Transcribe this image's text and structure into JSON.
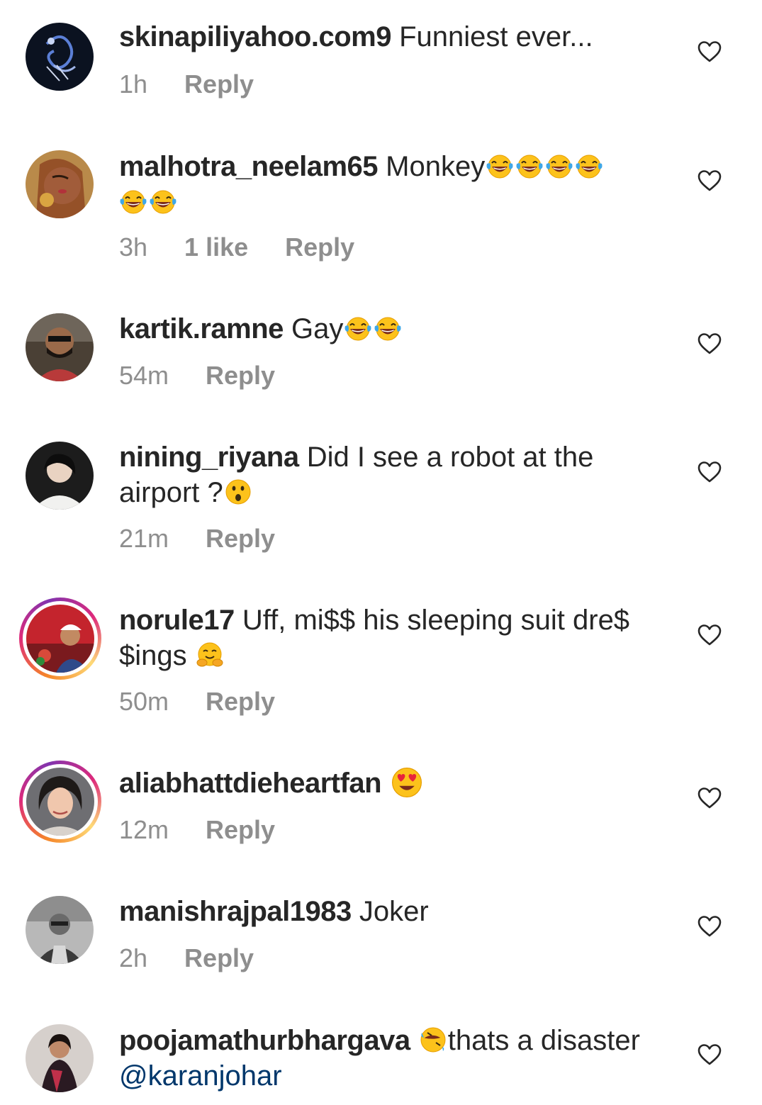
{
  "comments": [
    {
      "username": "skinapiliyahoo.com9",
      "text": "Funniest ever...",
      "time": "1h",
      "likes": "",
      "reply": "Reply"
    },
    {
      "username": "malhotra_neelam65",
      "text": "Monkey",
      "text2": "",
      "time": "3h",
      "likes": "1 like",
      "reply": "Reply"
    },
    {
      "username": "kartik.ramne",
      "text": "Gay",
      "time": "54m",
      "likes": "",
      "reply": "Reply"
    },
    {
      "username": "nining_riyana",
      "text": "Did I see a robot at the",
      "text2": "airport ?",
      "time": "21m",
      "likes": "",
      "reply": "Reply"
    },
    {
      "username": "norule17",
      "text": "Uff, mi$$ his sleeping suit dre$",
      "text2": "$ings",
      "time": "50m",
      "likes": "",
      "reply": "Reply"
    },
    {
      "username": "aliabhattdieheartfan",
      "text": "",
      "time": "12m",
      "likes": "",
      "reply": "Reply"
    },
    {
      "username": "manishrajpal1983",
      "text": "Joker",
      "time": "2h",
      "likes": "",
      "reply": "Reply"
    },
    {
      "username": "poojamathurbhargava",
      "text": "thats a disaster",
      "mention": "@karanjohar",
      "time": "",
      "likes": "",
      "reply": ""
    }
  ],
  "icons": {
    "heart": "heart-outline-icon",
    "laugh": "tears-of-joy-emoji",
    "shock": "astonished-face-emoji",
    "hug": "hugging-face-emoji",
    "love": "heart-eyes-emoji",
    "rofl": "rolling-laughing-emoji"
  },
  "colors": {
    "text": "#262626",
    "muted": "#8e8e8e",
    "mention": "#00376b",
    "story_ring_start": "#f58529",
    "story_ring_end": "#dd2a7b"
  }
}
